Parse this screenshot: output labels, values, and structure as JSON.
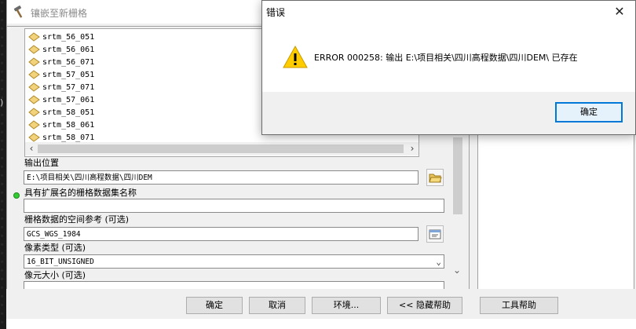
{
  "tool_window": {
    "title": "镶嵌至新栅格",
    "input_list": {
      "items": [
        "srtm_56_051",
        "srtm_56_061",
        "srtm_56_071",
        "srtm_57_051",
        "srtm_57_071",
        "srtm_57_061",
        "srtm_58_051",
        "srtm_58_061",
        "srtm_58_071"
      ]
    },
    "output_location": {
      "label": "输出位置",
      "value": "E:\\项目相关\\四川高程数据\\四川DEM"
    },
    "dataset_name": {
      "label": "具有扩展名的栅格数据集名称",
      "value": ""
    },
    "spatial_ref": {
      "label": "栅格数据的空间参考 (可选)",
      "value": "GCS_WGS_1984"
    },
    "pixel_type": {
      "label": "像素类型 (可选)",
      "value": "16_BIT_UNSIGNED"
    },
    "cell_size": {
      "label": "像元大小 (可选)"
    },
    "buttons": {
      "ok": "确定",
      "cancel": "取消",
      "environments": "环境...",
      "hide_help": "<< 隐藏帮助",
      "tool_help": "工具帮助"
    }
  },
  "error_dialog": {
    "title": "错误",
    "message": "ERROR 000258: 输出 E:\\项目相关\\四川高程数据\\四川DEM\\ 已存在",
    "ok_label": "确定"
  },
  "colors": {
    "required_indicator": "#33cc33",
    "warning_yellow": "#ffcc00",
    "focus_blue": "#0078d7"
  },
  "icons": {
    "tool_title": "hammer-icon",
    "raster_item": "raster-dataset-icon",
    "browse": "folder-open-icon",
    "spatial_ref": "properties-icon",
    "warning": "warning-icon",
    "close": "close-icon"
  }
}
